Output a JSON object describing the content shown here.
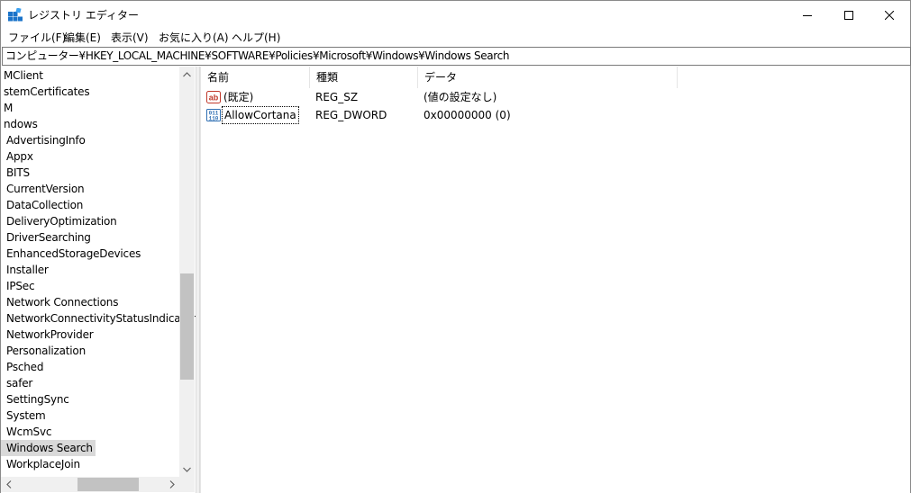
{
  "window": {
    "title": "レジストリ エディター"
  },
  "menu": {
    "items": [
      "ファイル(F)",
      "編集(E)",
      "表示(V)",
      "お気に入り(A)",
      "ヘルプ(H)"
    ]
  },
  "address": {
    "path": "コンピューター¥HKEY_LOCAL_MACHINE¥SOFTWARE¥Policies¥Microsoft¥Windows¥Windows Search"
  },
  "tree": {
    "items": [
      "MClient",
      "stemCertificates",
      "M",
      "ndows",
      "AdvertisingInfo",
      "Appx",
      "BITS",
      "CurrentVersion",
      "DataCollection",
      "DeliveryOptimization",
      "DriverSearching",
      "EnhancedStorageDevices",
      "Installer",
      "IPSec",
      "Network Connections",
      "NetworkConnectivityStatusIndicator",
      "NetworkProvider",
      "Personalization",
      "Psched",
      "safer",
      "SettingSync",
      "System",
      "WcmSvc",
      "Windows Search",
      "WorkplaceJoin"
    ],
    "selected": "Windows Search"
  },
  "list": {
    "columns": {
      "name": "名前",
      "type": "種類",
      "data": "データ"
    },
    "rows": [
      {
        "icon": "string-value-icon",
        "name": "(既定)",
        "type": "REG_SZ",
        "data": "(値の設定なし)"
      },
      {
        "icon": "dword-value-icon",
        "name": "AllowCortana",
        "type": "REG_DWORD",
        "data": "0x00000000 (0)"
      }
    ]
  },
  "colors": {
    "selection": "#d9d9d9",
    "scrollbar_thumb": "#c2c2c2",
    "string_icon": "#c0392b",
    "dword_icon": "#2f6fb3"
  }
}
